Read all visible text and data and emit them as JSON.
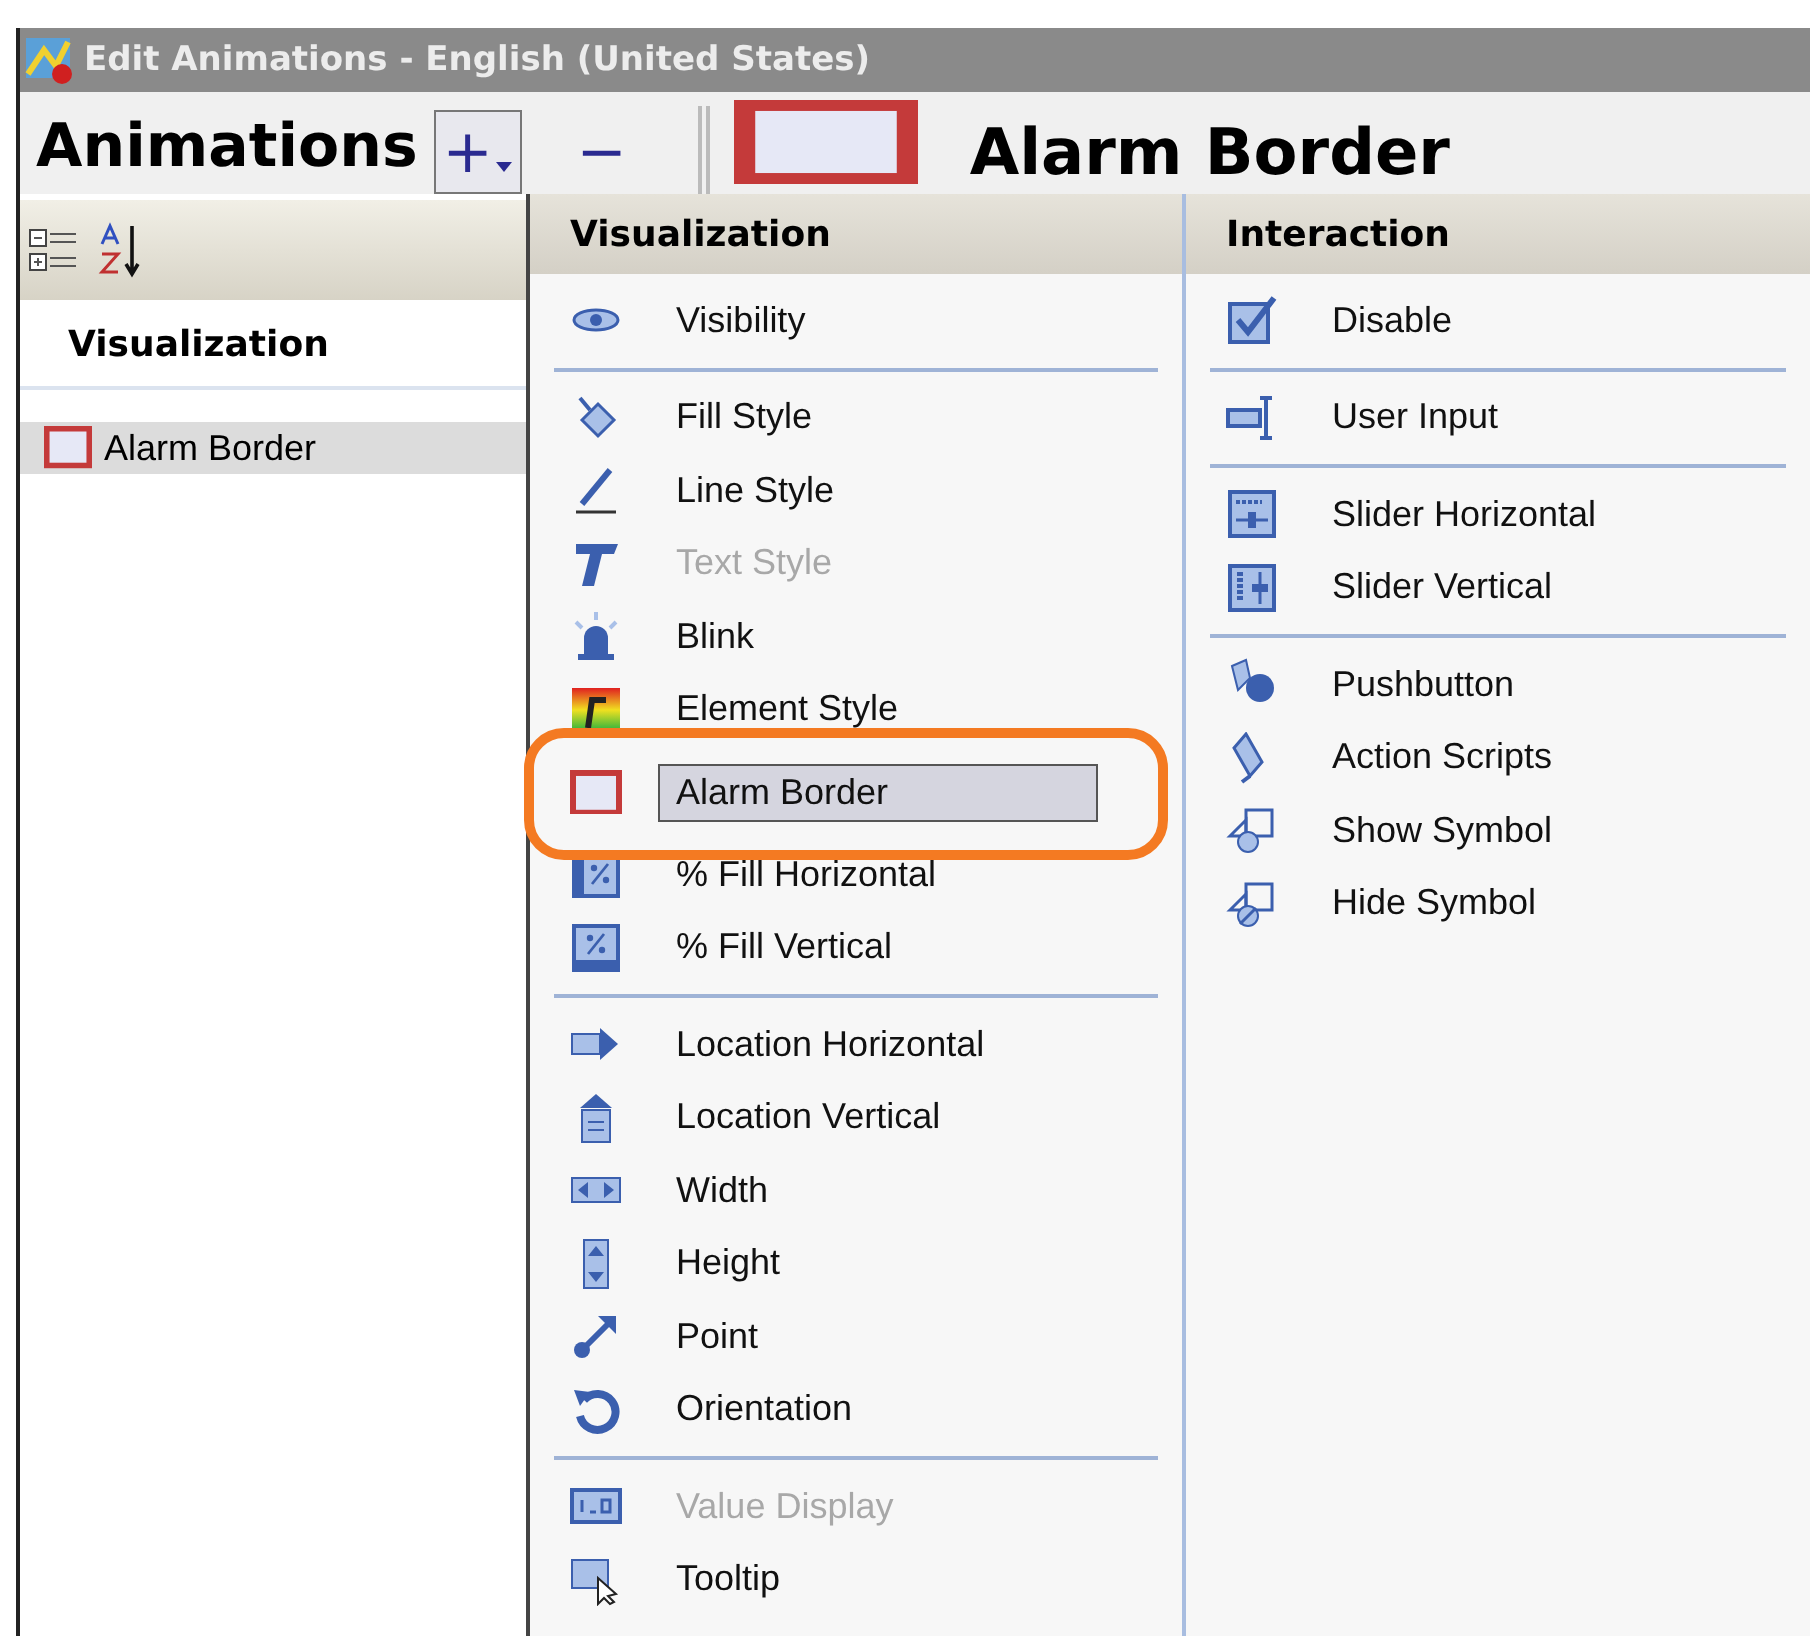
{
  "window": {
    "title": "Edit Animations - English (United States)"
  },
  "toolbar": {
    "title": "Animations",
    "add_button": "+",
    "remove_button": "−",
    "current_animation": "Alarm Border"
  },
  "left_panel": {
    "section": "Visualization",
    "items": [
      {
        "label": "Alarm Border",
        "selected": true
      }
    ]
  },
  "menu": {
    "columns": [
      {
        "header": "Visualization",
        "groups": [
          {
            "items": [
              {
                "label": "Visibility",
                "disabled": false,
                "selected": false
              }
            ]
          },
          {
            "items": [
              {
                "label": "Fill Style",
                "disabled": false,
                "selected": false
              },
              {
                "label": "Line Style",
                "disabled": false,
                "selected": false
              },
              {
                "label": "Text Style",
                "disabled": true,
                "selected": false
              },
              {
                "label": "Blink",
                "disabled": false,
                "selected": false
              },
              {
                "label": "Element Style",
                "disabled": false,
                "selected": false
              },
              {
                "label": "Alarm Border",
                "disabled": false,
                "selected": true
              },
              {
                "label": "% Fill Horizontal",
                "disabled": false,
                "selected": false
              },
              {
                "label": "% Fill Vertical",
                "disabled": false,
                "selected": false
              }
            ]
          },
          {
            "items": [
              {
                "label": "Location Horizontal",
                "disabled": false,
                "selected": false
              },
              {
                "label": "Location Vertical",
                "disabled": false,
                "selected": false
              },
              {
                "label": "Width",
                "disabled": false,
                "selected": false
              },
              {
                "label": "Height",
                "disabled": false,
                "selected": false
              },
              {
                "label": "Point",
                "disabled": false,
                "selected": false
              },
              {
                "label": "Orientation",
                "disabled": false,
                "selected": false
              }
            ]
          },
          {
            "items": [
              {
                "label": "Value Display",
                "disabled": true,
                "selected": false
              },
              {
                "label": "Tooltip",
                "disabled": false,
                "selected": false
              }
            ]
          }
        ]
      },
      {
        "header": "Interaction",
        "groups": [
          {
            "items": [
              {
                "label": "Disable",
                "disabled": false,
                "selected": false
              }
            ]
          },
          {
            "items": [
              {
                "label": "User Input",
                "disabled": false,
                "selected": false
              }
            ]
          },
          {
            "items": [
              {
                "label": "Slider Horizontal",
                "disabled": false,
                "selected": false
              },
              {
                "label": "Slider Vertical",
                "disabled": false,
                "selected": false
              }
            ]
          },
          {
            "items": [
              {
                "label": "Pushbutton",
                "disabled": false,
                "selected": false
              },
              {
                "label": "Action Scripts",
                "disabled": false,
                "selected": false
              },
              {
                "label": "Show Symbol",
                "disabled": false,
                "selected": false
              },
              {
                "label": "Hide Symbol",
                "disabled": false,
                "selected": false
              }
            ]
          }
        ]
      }
    ]
  }
}
